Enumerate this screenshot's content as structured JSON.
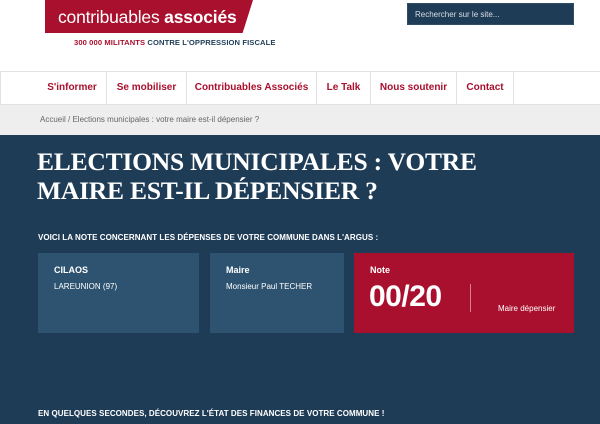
{
  "header": {
    "logo_light": "contribuables ",
    "logo_bold": "associés",
    "tagline_highlight": "300 000 MILITANTS",
    "tagline_rest": " CONTRE L'OPPRESSION FISCALE",
    "search_placeholder": "Rechercher sur le site..."
  },
  "nav": {
    "items": [
      {
        "label": "S'informer"
      },
      {
        "label": "Se mobiliser"
      },
      {
        "label": "Contribuables Associés"
      },
      {
        "label": "Le Talk"
      },
      {
        "label": "Nous soutenir"
      },
      {
        "label": "Contact"
      }
    ]
  },
  "breadcrumb": {
    "home": "Accueil",
    "separator": " / ",
    "current": "Elections municipales : votre maire est-il dépensier ?"
  },
  "main": {
    "title": "Elections municipales : votre maire est-il dépensier ?",
    "intro": "VOICI LA NOTE CONCERNANT LES DÉPENSES DE VOTRE COMMUNE DANS L'ARGUS :",
    "commune": {
      "label": "CILAOS",
      "value": "LAREUNION (97)"
    },
    "maire": {
      "label": "Maire",
      "value": "Monsieur Paul TECHER"
    },
    "note": {
      "label": "Note",
      "score": "00/20",
      "verdict": "Maire dépensier"
    },
    "outro": "EN QUELQUES SECONDES, DÉCOUVREZ L'ÉTAT DES FINANCES DE VOTRE COMMUNE !"
  },
  "colors": {
    "brand_red": "#a8102d",
    "navy": "#1f3c57",
    "card_blue": "#2e5370",
    "breadcrumb_bg": "#eeeeee"
  }
}
